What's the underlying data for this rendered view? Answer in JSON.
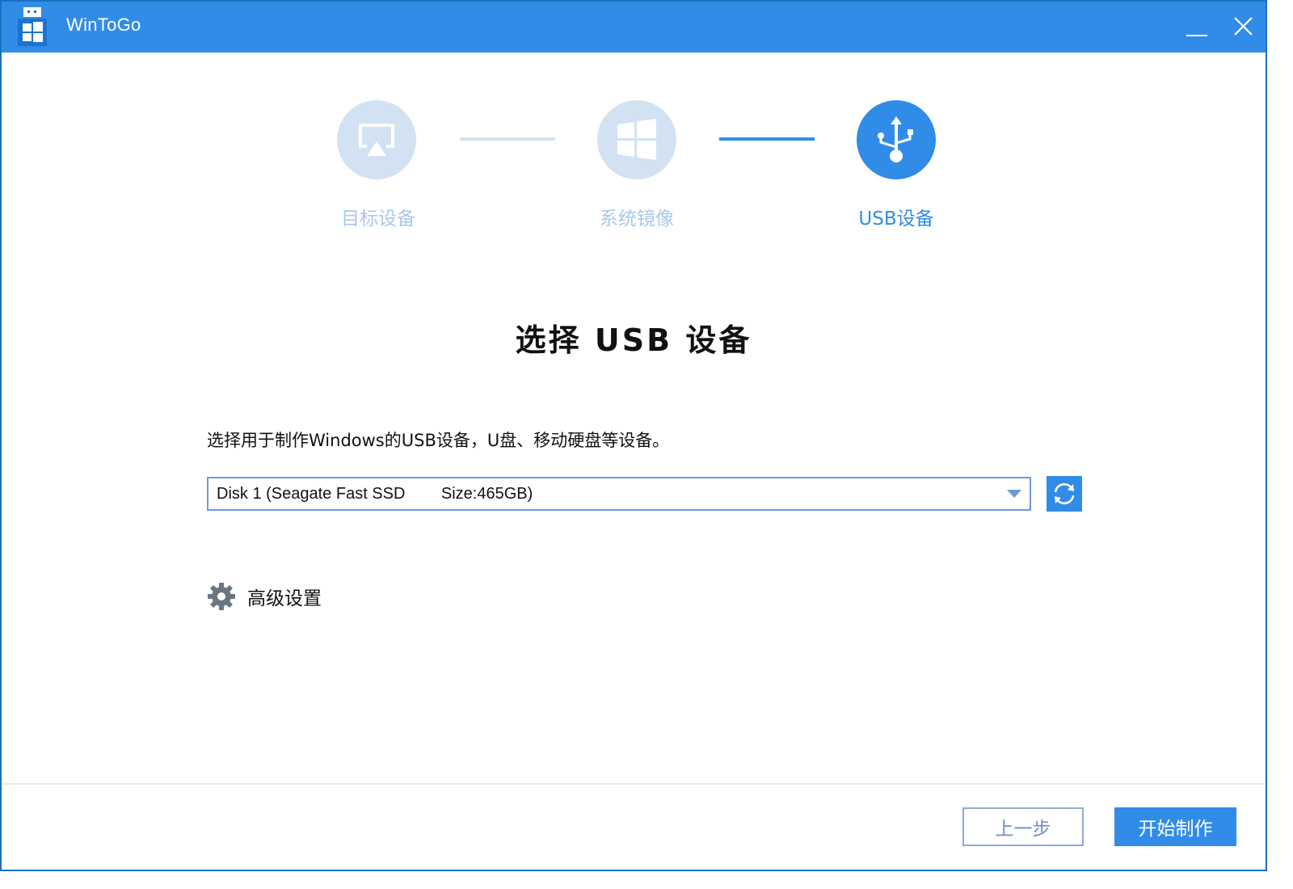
{
  "window": {
    "title": "WinToGo",
    "app_icon": "wintogo-usb-windows-icon",
    "controls": {
      "minimize": "minimize-icon",
      "close": "close-icon"
    }
  },
  "stepper": {
    "steps": [
      {
        "label": "目标设备",
        "icon": "display-cast-icon",
        "state": "inactive"
      },
      {
        "label": "系统镜像",
        "icon": "windows-logo-icon",
        "state": "inactive"
      },
      {
        "label": "USB设备",
        "icon": "usb-icon",
        "state": "active"
      }
    ],
    "current_step": 3,
    "total_steps": 3
  },
  "main": {
    "heading": "选择 USB 设备",
    "description": "选择用于制作Windows的USB设备，U盘、移动硬盘等设备。",
    "device_select": {
      "selected": "Disk 1 (Seagate Fast SSD        Size:465GB)",
      "arrow_icon": "dropdown-arrow-icon"
    },
    "refresh_icon": "refresh-icon",
    "advanced": {
      "label": "高级设置",
      "icon": "gear-icon"
    }
  },
  "footer": {
    "back_label": "上一步",
    "start_label": "开始制作"
  },
  "colors": {
    "accent": "#318ce7",
    "inactive_step": "#d2e2f3",
    "inactive_label": "#a9c8ea",
    "window_border": "#1a6fbf"
  }
}
